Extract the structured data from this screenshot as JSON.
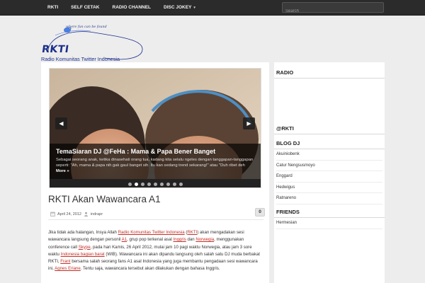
{
  "nav": {
    "items": [
      "RKTI",
      "Self Cetak",
      "Radio Channel",
      "Disc Jokey"
    ],
    "dropdown_caret": "▾",
    "search_placeholder": "Search"
  },
  "logo": {
    "slogan": "where fun can be found",
    "mark": "RKTI",
    "subtitle": "Radio Komunitas Twitter Indonesia",
    "brand_color": "#1c2f8c"
  },
  "slider": {
    "title": "TemaSiaran DJ @FeHa : Mama & Papa Bener Banget",
    "text": "Sebagai seorang anak, ketika dinasehati orang tua, kadang kita selalu ngeles dengan tanggapan-tanggapan seperti: \"Ah, mama & papa nih gak gaul banget sih. Itu kan sedang trend sekarang!\" atau \"Duh ribet deh",
    "more": "More »",
    "prev_icon": "arrow-left-icon",
    "next_icon": "arrow-right-icon",
    "dot_count": 9,
    "active_dot": 1
  },
  "post": {
    "title": "RKTI Akan Wawancara A1",
    "date": "April 24, 2012",
    "author": "indrapr",
    "comments": "0",
    "body": [
      {
        "t": "Jika tidak ada halangan, Insya Allah "
      },
      {
        "t": "Radio Komunitas Twitter Indonesia",
        "link": true
      },
      {
        "t": " ("
      },
      {
        "t": "RKTI",
        "link": true
      },
      {
        "t": ") akan mengadakan sesi wawancara langsung dengan personil "
      },
      {
        "t": "A1",
        "link": true
      },
      {
        "t": ", grup pop terkenal asal "
      },
      {
        "t": "Inggris",
        "link": true
      },
      {
        "t": " dan "
      },
      {
        "t": "Norwegia",
        "link": true
      },
      {
        "t": ", menggunakan conference call "
      },
      {
        "t": "Skype",
        "link": true
      },
      {
        "t": ", pada hari Kamis, 26 April 2012, mulai jam 10 pagi waktu Norwegia, atau jam 3 sore waktu "
      },
      {
        "t": "Indonesia bagian barat",
        "link": true
      },
      {
        "t": " (WIB). Wawancara ini akan dipandu langsung oleh salah satu DJ muda berbakat RKTI, "
      },
      {
        "t": "Frant",
        "link": true
      },
      {
        "t": " bersama salah seorang fans A1 asal Indonesia yang juga membantu pengadaan sesi wawancara ini, "
      },
      {
        "t": "Agnes Eriane",
        "link": true
      },
      {
        "t": ". Tentu saja, wawancara tersebut akan dilakukan dengan bahasa Inggris."
      }
    ],
    "link_color": "#c32f27"
  },
  "sidebar": {
    "radio_title": "RADIO",
    "rkti_title": "@RKTI",
    "blog_title": "BLOG DJ",
    "blog_items": [
      "Akuiniobenk",
      "Catur Nengsusmoyo",
      "Enggard",
      "Hedwigus",
      "Ratnareno"
    ],
    "friends_title": "FRIENDS",
    "friends_items": [
      "Hermesian"
    ]
  }
}
